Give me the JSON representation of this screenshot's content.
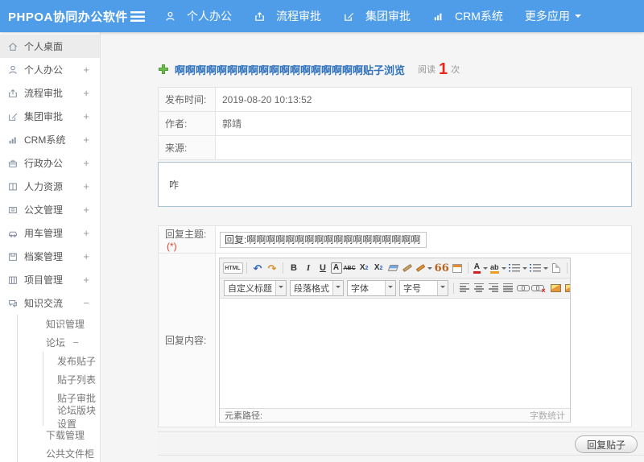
{
  "colors": {
    "header_blue": "#4f9de8",
    "title_blue": "#3273bd",
    "read_count_red": "#e8271c",
    "plus_green": "#6abf4b",
    "required_red": "#e0442c",
    "sidebar_active_bg": "#ececec"
  },
  "header": {
    "brand": "PHPOA协同办公软件",
    "nav": [
      {
        "label": "个人办公",
        "icon": "user-icon"
      },
      {
        "label": "流程审批",
        "icon": "flow-icon"
      },
      {
        "label": "集团审批",
        "icon": "edit-icon"
      },
      {
        "label": "CRM系统",
        "icon": "chart-icon"
      },
      {
        "label": "更多应用",
        "icon": "caret-down-icon"
      }
    ]
  },
  "sidebar": {
    "items": [
      {
        "label": "个人桌面",
        "icon": "home-icon",
        "level": 1,
        "active": true
      },
      {
        "label": "个人办公",
        "icon": "user-icon",
        "level": 1,
        "expand": "+"
      },
      {
        "label": "流程审批",
        "icon": "flow-icon",
        "level": 1,
        "expand": "+"
      },
      {
        "label": "集团审批",
        "icon": "edit-icon",
        "level": 1,
        "expand": "+"
      },
      {
        "label": "CRM系统",
        "icon": "chart-icon",
        "level": 1,
        "expand": "+"
      },
      {
        "label": "行政办公",
        "icon": "briefcase-icon",
        "level": 1,
        "expand": "+"
      },
      {
        "label": "人力资源",
        "icon": "book-icon",
        "level": 1,
        "expand": "+"
      },
      {
        "label": "公文管理",
        "icon": "doc-icon",
        "level": 1,
        "expand": "+"
      },
      {
        "label": "用车管理",
        "icon": "car-icon",
        "level": 1,
        "expand": "+"
      },
      {
        "label": "档案管理",
        "icon": "archive-icon",
        "level": 1,
        "expand": "+"
      },
      {
        "label": "项目管理",
        "icon": "project-icon",
        "level": 1,
        "expand": "+"
      },
      {
        "label": "知识交流",
        "icon": "chat-icon",
        "level": 1,
        "expand": "−"
      },
      {
        "label": "知识管理",
        "level": 2
      },
      {
        "label": "论坛",
        "level": 2,
        "expand": "−"
      },
      {
        "label": "发布贴子",
        "level": 3
      },
      {
        "label": "贴子列表",
        "level": 3
      },
      {
        "label": "贴子审批",
        "level": 3
      },
      {
        "label": "论坛版块设置",
        "level": 3
      },
      {
        "label": "下载管理",
        "level": 2
      },
      {
        "label": "公共文件柜",
        "level": 2
      }
    ]
  },
  "main": {
    "title": "啊啊啊啊啊啊啊啊啊啊啊啊啊啊啊啊啊啊贴子浏览",
    "read_label": "阅读",
    "read_count": "1",
    "read_unit": "次",
    "info_rows": [
      {
        "label": "发布时间:",
        "value": "2019-08-20 10:13:52"
      },
      {
        "label": "作者:",
        "value": "郭靖"
      },
      {
        "label": "来源:",
        "value": ""
      }
    ],
    "content_text": "咋",
    "reply_form": {
      "subject_label": "回复主题:",
      "required_mark": "(*)",
      "subject_value": "回复:啊啊啊啊啊啊啊啊啊啊啊啊啊啊啊啊啊啊",
      "content_label": "回复内容:",
      "submit_label": "回复贴子"
    },
    "editor": {
      "glyphs": {
        "html": "HTML",
        "undo": "↶",
        "redo": "↷",
        "bold": "B",
        "italic": "I",
        "underline": "U",
        "font_box": "A",
        "strike": "ABC",
        "sup_base": "X",
        "sup_exp": "2",
        "sub_base": "X",
        "sub_exp": "2",
        "quote": "66",
        "fontcolor": "A",
        "highlight": "ab"
      },
      "selects": [
        {
          "label": "自定义标题"
        },
        {
          "label": "段落格式"
        },
        {
          "label": "字体"
        },
        {
          "label": "字号"
        }
      ],
      "status_left": "元素路径:",
      "status_right": "字数统计"
    }
  }
}
